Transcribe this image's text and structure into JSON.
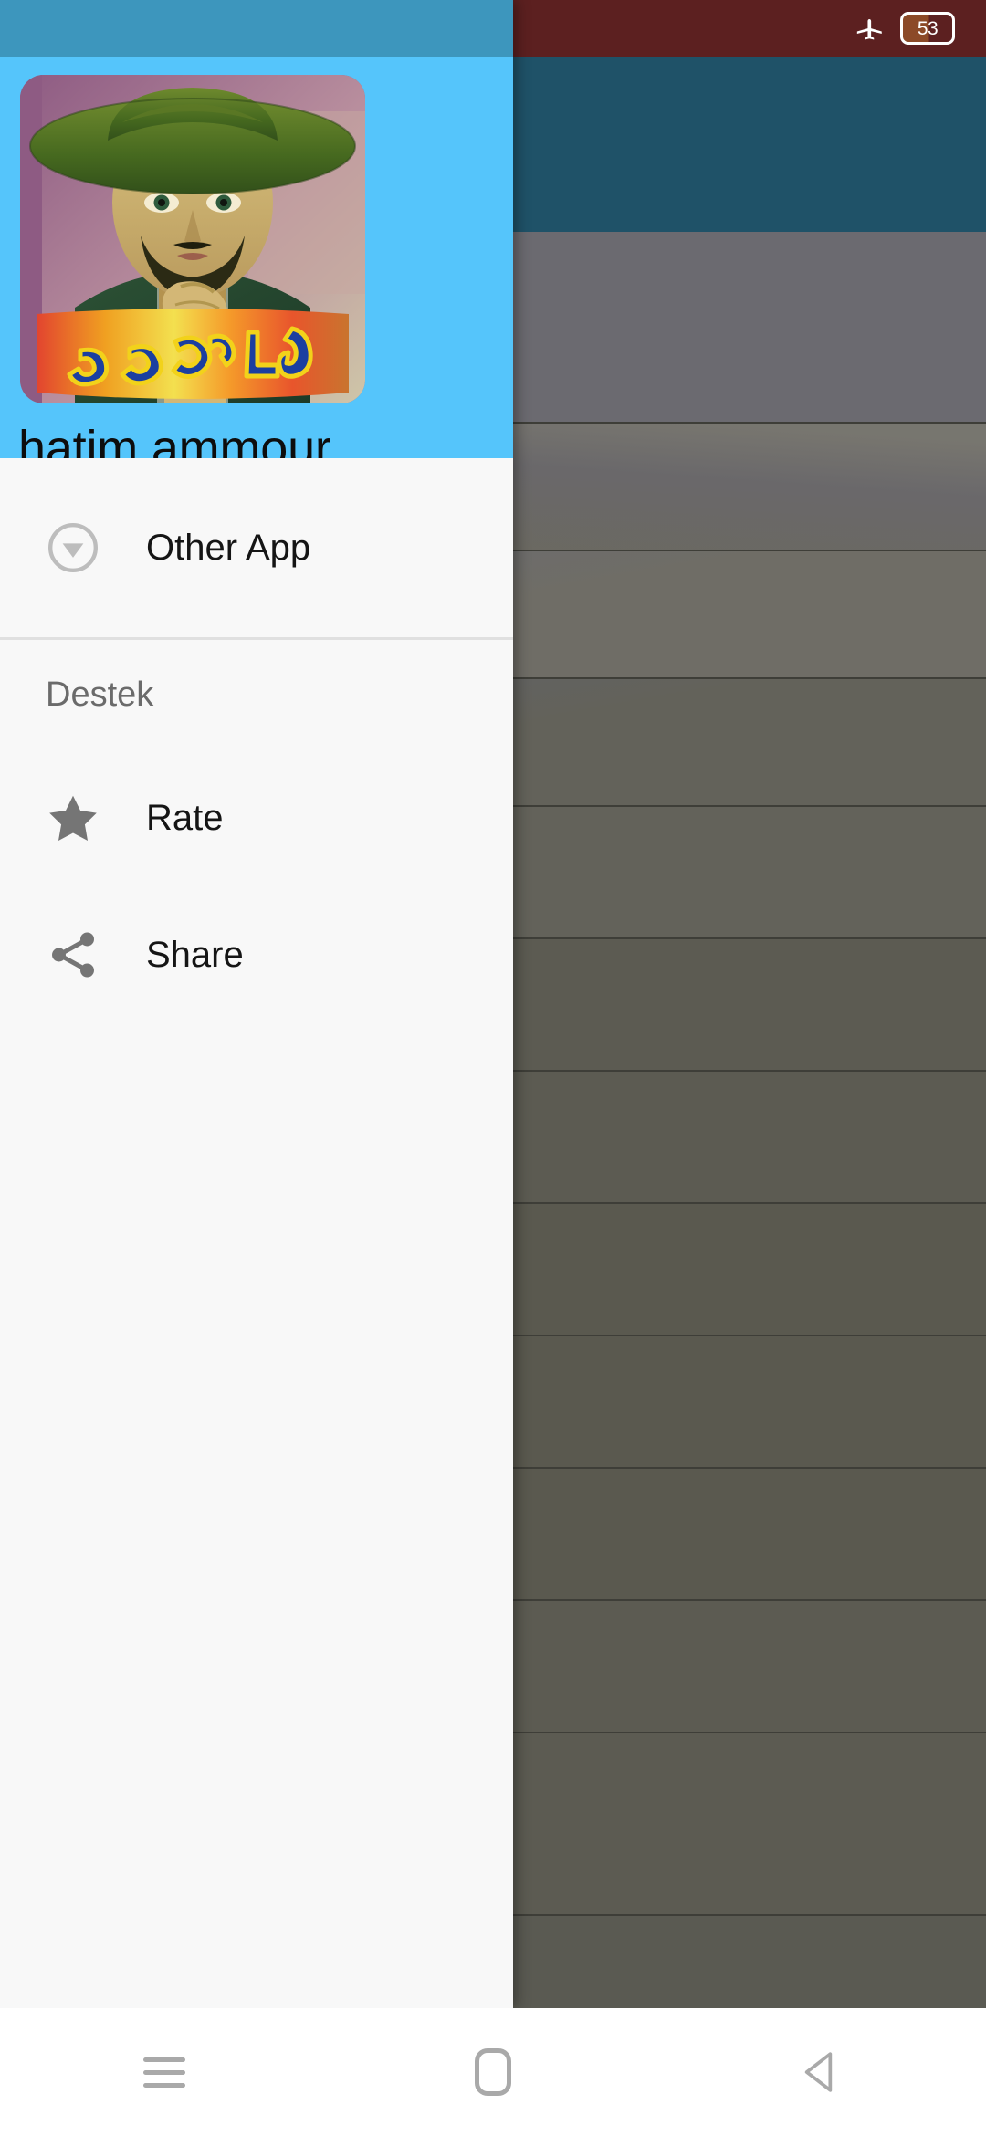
{
  "status_bar": {
    "airplane_icon": "airplane-mode-icon",
    "battery_level": "53"
  },
  "drawer": {
    "header": {
      "app_name": "hatim ammour",
      "profile_image_alt": "hatim ammour album cover",
      "profile_image_arabic_text": "حاتم عمور",
      "background_color": "#55c5fb",
      "status_strip_color": "#3d96bd"
    },
    "menu_items": [
      {
        "id": "other-app",
        "label": "Other App",
        "icon": "download-circle-icon"
      }
    ],
    "sections": [
      {
        "id": "destek",
        "title": "Destek",
        "items": [
          {
            "id": "rate",
            "label": "Rate",
            "icon": "star-icon"
          },
          {
            "id": "share",
            "label": "Share",
            "icon": "share-icon"
          }
        ]
      }
    ]
  },
  "system_nav": {
    "recents_label": "recents-icon",
    "home_label": "home-icon",
    "back_label": "back-icon"
  }
}
